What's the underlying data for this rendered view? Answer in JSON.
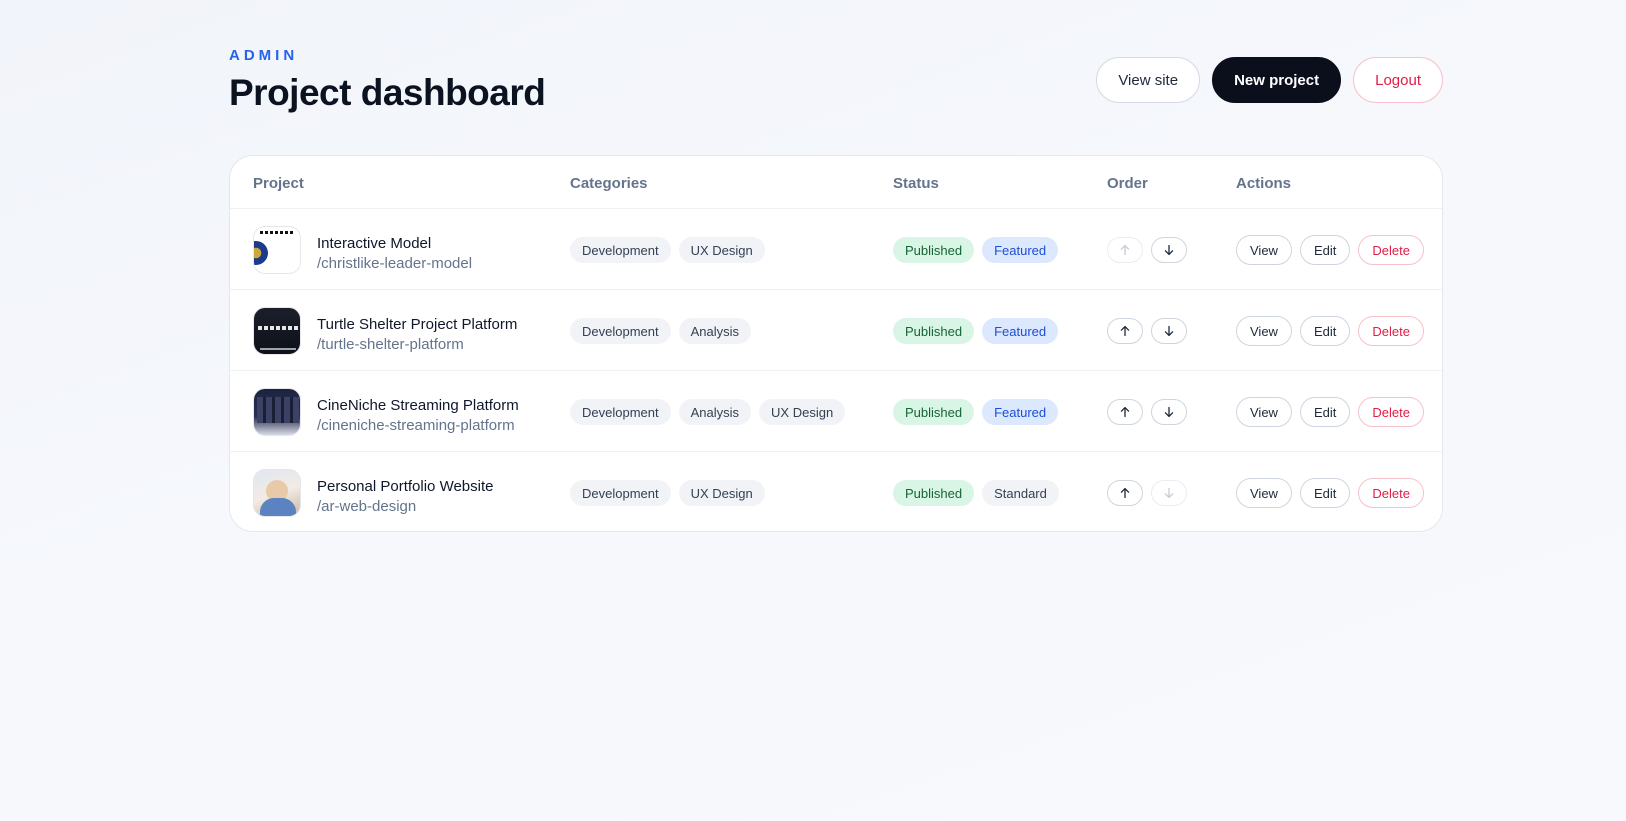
{
  "header": {
    "eyebrow": "ADMIN",
    "title": "Project dashboard",
    "view_site_label": "View site",
    "new_project_label": "New project",
    "logout_label": "Logout"
  },
  "table": {
    "columns": [
      "Project",
      "Categories",
      "Status",
      "Order",
      "Actions"
    ],
    "action_labels": {
      "view": "View",
      "edit": "Edit",
      "delete": "Delete"
    },
    "rows": [
      {
        "name": "Interactive Model",
        "slug": "/christlike-leader-model",
        "categories": [
          "Development",
          "UX Design"
        ],
        "status": [
          "Published",
          "Featured"
        ],
        "move_up_enabled": false,
        "move_down_enabled": true
      },
      {
        "name": "Turtle Shelter Project Platform",
        "slug": "/turtle-shelter-platform",
        "categories": [
          "Development",
          "Analysis"
        ],
        "status": [
          "Published",
          "Featured"
        ],
        "move_up_enabled": true,
        "move_down_enabled": true
      },
      {
        "name": "CineNiche Streaming Platform",
        "slug": "/cineniche-streaming-platform",
        "categories": [
          "Development",
          "Analysis",
          "UX Design"
        ],
        "status": [
          "Published",
          "Featured"
        ],
        "move_up_enabled": true,
        "move_down_enabled": true
      },
      {
        "name": "Personal Portfolio Website",
        "slug": "/ar-web-design",
        "categories": [
          "Development",
          "UX Design"
        ],
        "status": [
          "Published",
          "Standard"
        ],
        "move_up_enabled": true,
        "move_down_enabled": false
      }
    ]
  },
  "colors": {
    "accent": "#2563eb",
    "primary_button": "#0b0f1c",
    "danger": "#e11d48",
    "published_bg": "#d9f5e6",
    "featured_bg": "#dbe8fd"
  }
}
